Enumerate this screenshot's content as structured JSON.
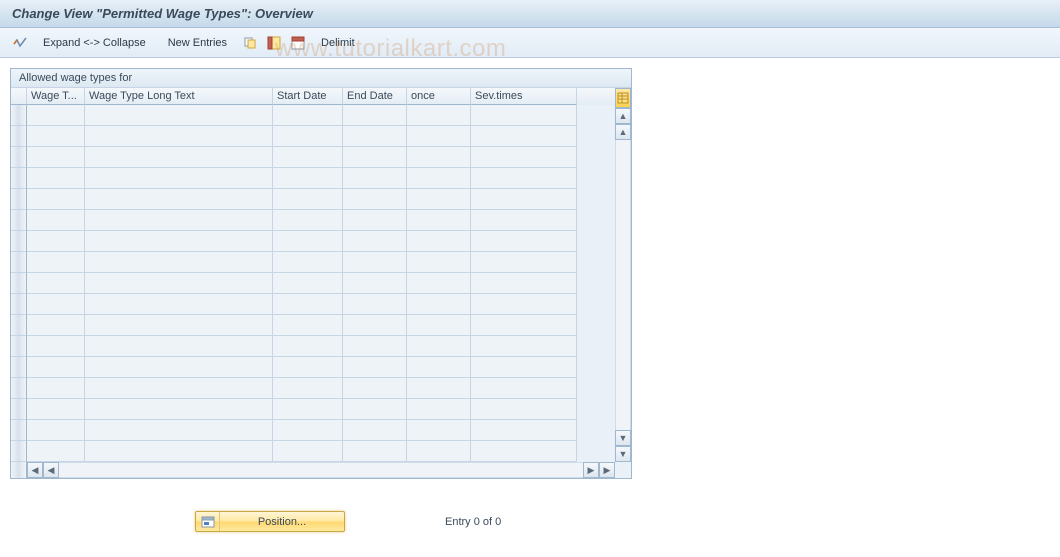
{
  "title": "Change View \"Permitted Wage Types\": Overview",
  "toolbar": {
    "expand_collapse": "Expand <-> Collapse",
    "new_entries": "New Entries",
    "delimit": "Delimit"
  },
  "panel": {
    "header": "Allowed wage types for"
  },
  "columns": {
    "wage_type": "Wage T...",
    "wage_type_long": "Wage Type Long Text",
    "start_date": "Start Date",
    "end_date": "End Date",
    "once": "once",
    "sev_times": "Sev.times"
  },
  "rows": [
    {
      "wage_type": "",
      "wage_type_long": "",
      "start_date": "",
      "end_date": "",
      "once": "",
      "sev_times": ""
    },
    {
      "wage_type": "",
      "wage_type_long": "",
      "start_date": "",
      "end_date": "",
      "once": "",
      "sev_times": ""
    },
    {
      "wage_type": "",
      "wage_type_long": "",
      "start_date": "",
      "end_date": "",
      "once": "",
      "sev_times": ""
    },
    {
      "wage_type": "",
      "wage_type_long": "",
      "start_date": "",
      "end_date": "",
      "once": "",
      "sev_times": ""
    },
    {
      "wage_type": "",
      "wage_type_long": "",
      "start_date": "",
      "end_date": "",
      "once": "",
      "sev_times": ""
    },
    {
      "wage_type": "",
      "wage_type_long": "",
      "start_date": "",
      "end_date": "",
      "once": "",
      "sev_times": ""
    },
    {
      "wage_type": "",
      "wage_type_long": "",
      "start_date": "",
      "end_date": "",
      "once": "",
      "sev_times": ""
    },
    {
      "wage_type": "",
      "wage_type_long": "",
      "start_date": "",
      "end_date": "",
      "once": "",
      "sev_times": ""
    },
    {
      "wage_type": "",
      "wage_type_long": "",
      "start_date": "",
      "end_date": "",
      "once": "",
      "sev_times": ""
    },
    {
      "wage_type": "",
      "wage_type_long": "",
      "start_date": "",
      "end_date": "",
      "once": "",
      "sev_times": ""
    },
    {
      "wage_type": "",
      "wage_type_long": "",
      "start_date": "",
      "end_date": "",
      "once": "",
      "sev_times": ""
    },
    {
      "wage_type": "",
      "wage_type_long": "",
      "start_date": "",
      "end_date": "",
      "once": "",
      "sev_times": ""
    },
    {
      "wage_type": "",
      "wage_type_long": "",
      "start_date": "",
      "end_date": "",
      "once": "",
      "sev_times": ""
    },
    {
      "wage_type": "",
      "wage_type_long": "",
      "start_date": "",
      "end_date": "",
      "once": "",
      "sev_times": ""
    },
    {
      "wage_type": "",
      "wage_type_long": "",
      "start_date": "",
      "end_date": "",
      "once": "",
      "sev_times": ""
    },
    {
      "wage_type": "",
      "wage_type_long": "",
      "start_date": "",
      "end_date": "",
      "once": "",
      "sev_times": ""
    },
    {
      "wage_type": "",
      "wage_type_long": "",
      "start_date": "",
      "end_date": "",
      "once": "",
      "sev_times": ""
    }
  ],
  "footer": {
    "position": "Position...",
    "entry": "Entry 0 of 0"
  },
  "watermark": "www.tutorialkart.com"
}
